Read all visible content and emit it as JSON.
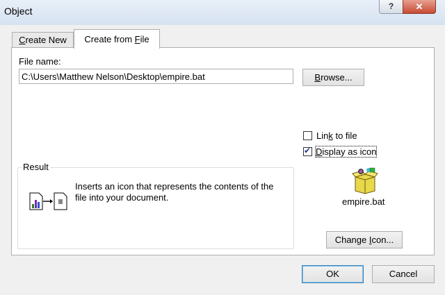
{
  "window": {
    "title": "Object",
    "help": "?",
    "close": "✕"
  },
  "tabs": [
    {
      "label_pre": "",
      "label_u": "C",
      "label_post": "reate New"
    },
    {
      "label_pre": "Create from ",
      "label_u": "F",
      "label_post": "ile"
    }
  ],
  "file": {
    "label": "File name:",
    "path": "C:\\Users\\Matthew Nelson\\Desktop\\empire.bat"
  },
  "browse": {
    "pre": "",
    "u": "B",
    "post": "rowse..."
  },
  "link_to_file": {
    "pre": "Lin",
    "u": "k",
    "post": " to file",
    "checked": false
  },
  "display_as_icon": {
    "pre": "",
    "u": "D",
    "post": "isplay as icon",
    "checked": true
  },
  "icon": {
    "name": "batch-file-icon",
    "caption": "empire.bat"
  },
  "result": {
    "legend": "Result",
    "text": "Inserts an icon that represents the contents of the file into your document."
  },
  "change_icon": {
    "pre": "Change ",
    "u": "I",
    "post": "con..."
  },
  "ok": {
    "label": "OK"
  },
  "cancel": {
    "label": "Cancel"
  }
}
